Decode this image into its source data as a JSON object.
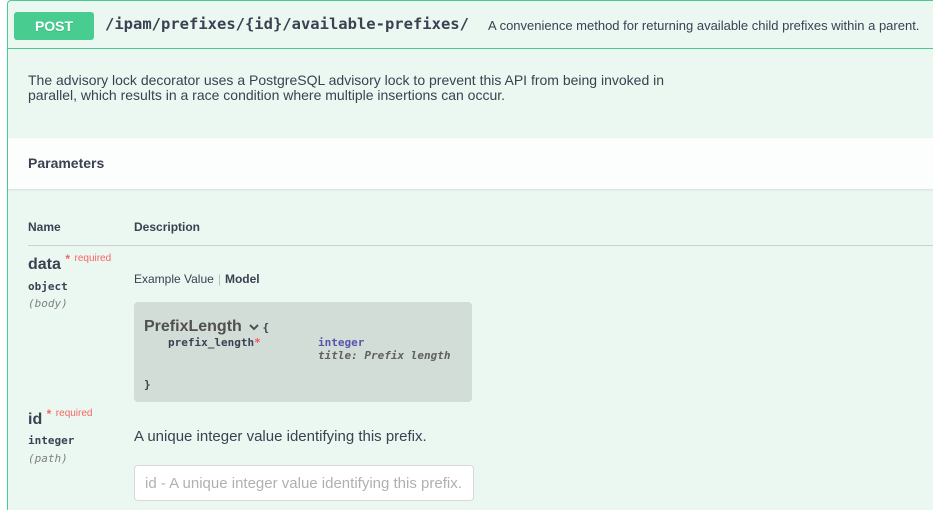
{
  "operation": {
    "method": "POST",
    "path": "/ipam/prefixes/{id}/available-prefixes/",
    "summary": "A convenience method for returning available child prefixes within a parent.",
    "description": "The advisory lock decorator uses a PostgreSQL advisory lock to prevent this API from being invoked in parallel, which results in a race condition where multiple insertions can occur."
  },
  "parameters": {
    "section_title": "Parameters",
    "col_name": "Name",
    "col_description": "Description",
    "items": [
      {
        "name": "data",
        "required_star": "*",
        "required_label": "required",
        "type": "object",
        "in": "(body)",
        "tab_example": "Example Value",
        "tab_model": "Model",
        "model": {
          "name": "PrefixLength",
          "open_brace": "{",
          "close_brace": "}",
          "property_name": "prefix_length",
          "property_required": "*",
          "property_type": "integer",
          "property_title": "title: Prefix length"
        }
      },
      {
        "name": "id",
        "required_star": "*",
        "required_label": "required",
        "type": "integer",
        "in": "(path)",
        "description": "A unique integer value identifying this prefix.",
        "input_value": "",
        "input_placeholder": "id - A unique integer value identifying this prefix."
      }
    ]
  },
  "colors": {
    "post_accent": "#49cc90",
    "post_background": "#ebf7f1",
    "required": "#ff0000"
  },
  "icons": {
    "model_toggle": "chevron-down-icon"
  }
}
